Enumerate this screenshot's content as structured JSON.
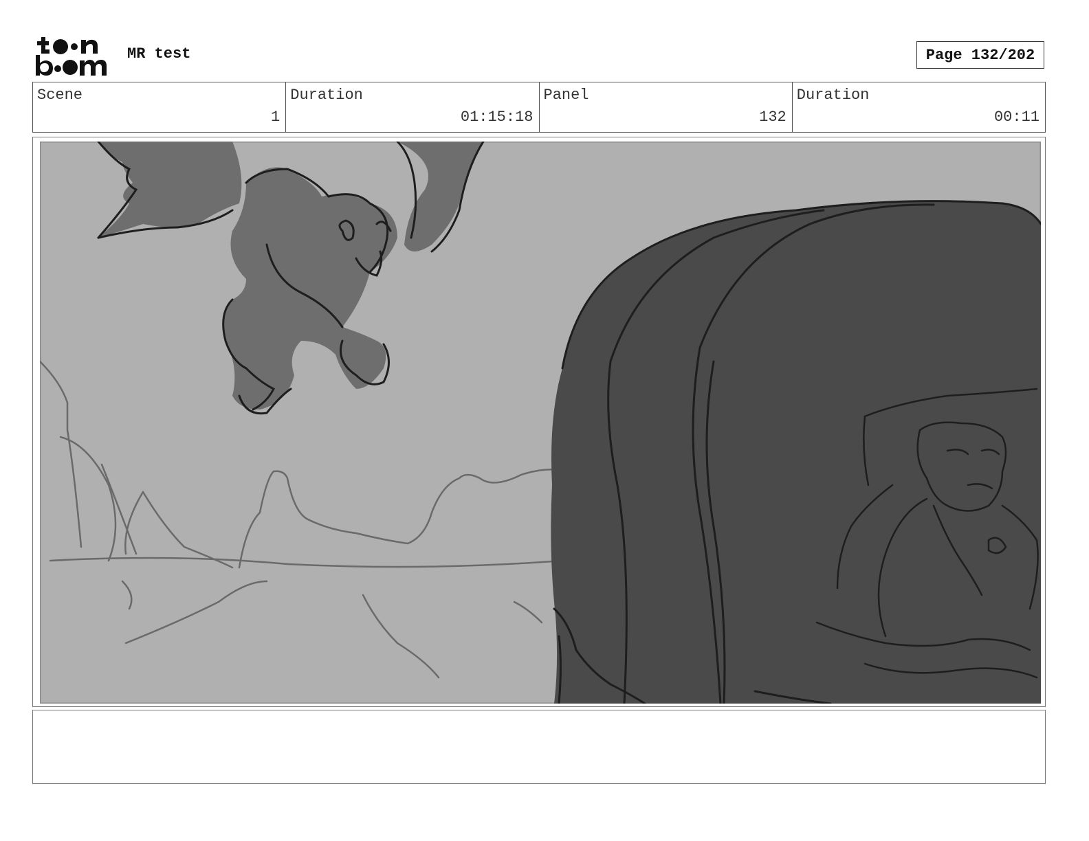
{
  "header": {
    "logo_text": "toon boom",
    "project_title": "MR test",
    "page_label": "Page 132/202"
  },
  "info": [
    {
      "label": "Scene",
      "value": "1"
    },
    {
      "label": "Duration",
      "value": "01:15:18"
    },
    {
      "label": "Panel",
      "value": "132"
    },
    {
      "label": "Duration",
      "value": "00:11"
    }
  ],
  "panel": {
    "colors": {
      "sky": "#b0b0b0",
      "dark": "#4a4a4a",
      "bat": "#6e6e6e",
      "line": "#1e1e1e",
      "sketch": "#6a6a6a"
    }
  },
  "notes": {
    "text": ""
  }
}
